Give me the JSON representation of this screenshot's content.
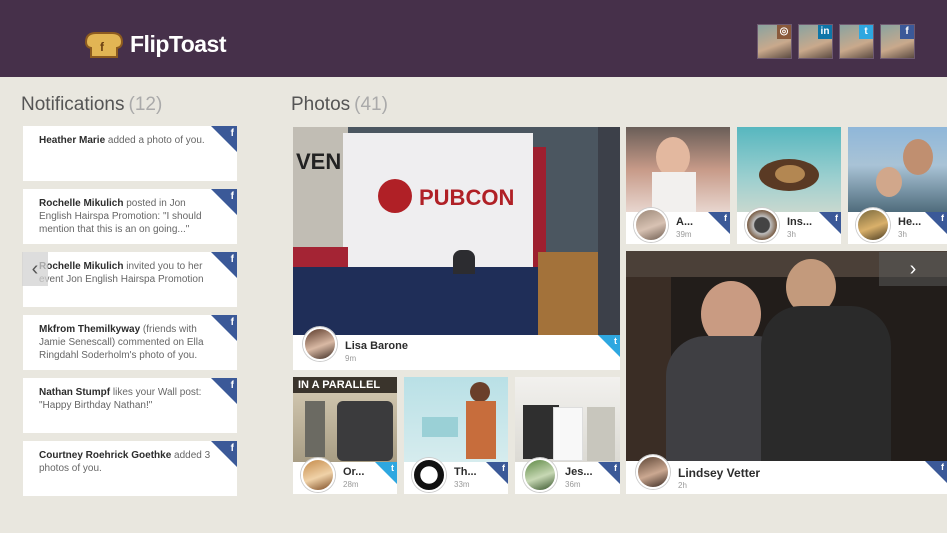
{
  "app": {
    "name": "FlipToast"
  },
  "accounts": [
    {
      "network": "instagram",
      "badge": "◎",
      "color": "#8a5a3c"
    },
    {
      "network": "linkedin",
      "badge": "in",
      "color": "#0e76a8"
    },
    {
      "network": "twitter",
      "badge": "t",
      "color": "#2ea7e0"
    },
    {
      "network": "facebook",
      "badge": "f",
      "color": "#3b5998"
    }
  ],
  "notifications": {
    "title": "Notifications",
    "count": "(12)",
    "items": [
      {
        "actor": "Heather Marie",
        "text": " added a photo of you."
      },
      {
        "actor": "Rochelle Mikulich",
        "text": " posted in Jon English Hairspa Promotion: \"I should mention that this is an on going...\""
      },
      {
        "actor": "Rochelle Mikulich",
        "text": " invited you to her event Jon English Hairspa Promotion"
      },
      {
        "actor": "Mkfrom Themilkyway",
        "text": " (friends with Jamie Senescall) commented on Ella Ringdahl Soderholm's photo of you."
      },
      {
        "actor": "Nathan Stumpf",
        "text": " likes your Wall post: \"Happy Birthday Nathan!\""
      },
      {
        "actor": "Courtney Roehrick Goethke",
        "text": " added 3 photos of you."
      }
    ],
    "network_badge": "f",
    "prev_arrow": "‹"
  },
  "photos": {
    "title": "Photos",
    "count": "(41)",
    "next_arrow": "›",
    "tiles": [
      {
        "name": "Lisa Barone",
        "time": "9m",
        "network": "twitter",
        "badge": "t",
        "banner_text": "PUBCON",
        "banner_text_2": "VEN"
      },
      {
        "name": "A...",
        "time": "39m",
        "network": "facebook",
        "badge": "f"
      },
      {
        "name": "Ins...",
        "time": "3h",
        "network": "facebook",
        "badge": "f"
      },
      {
        "name": "He...",
        "time": "3h",
        "network": "facebook",
        "badge": "f"
      },
      {
        "name": "Lindsey Vetter",
        "time": "2h",
        "network": "facebook",
        "badge": "f"
      },
      {
        "name": "Or...",
        "time": "28m",
        "network": "twitter",
        "badge": "t",
        "overlay_text": "IN A PARALLEL"
      },
      {
        "name": "Th...",
        "time": "33m",
        "network": "facebook",
        "badge": "f"
      },
      {
        "name": "Jes...",
        "time": "36m",
        "network": "facebook",
        "badge": "f"
      }
    ]
  }
}
